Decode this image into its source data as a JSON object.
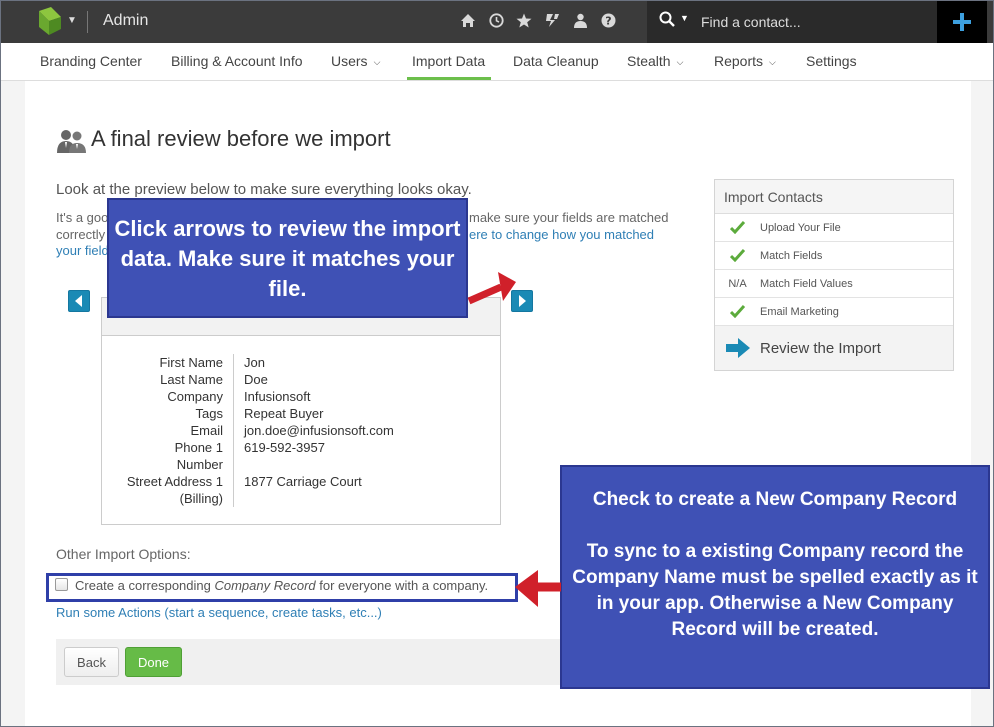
{
  "app": {
    "title": "Admin"
  },
  "search": {
    "placeholder": "Find a contact..."
  },
  "top_icons": [
    "home-icon",
    "history-icon",
    "star-icon",
    "marketplace-icon",
    "user-icon",
    "help-icon"
  ],
  "nav": {
    "items": [
      {
        "label": "Branding Center"
      },
      {
        "label": "Billing & Account Info"
      },
      {
        "label": "Users"
      },
      {
        "label": "Import Data"
      },
      {
        "label": "Data Cleanup"
      },
      {
        "label": "Stealth"
      },
      {
        "label": "Reports"
      },
      {
        "label": "Settings"
      }
    ],
    "active": "Import Data"
  },
  "page": {
    "title": "A final review before we import",
    "intro": "Look at the preview below to make sure everything looks okay.",
    "help_left_1": "It's a goo",
    "help_left_2": "correctly",
    "help_left_3": "your field",
    "help_right_1": "make sure your fields are matched",
    "help_right_link": "ere to change how you matched"
  },
  "preview": {
    "rows": [
      {
        "label": "First Name",
        "value": "Jon"
      },
      {
        "label": "Last Name",
        "value": "Doe"
      },
      {
        "label": "Company",
        "value": "Infusionsoft"
      },
      {
        "label": "Tags",
        "value": "Repeat Buyer"
      },
      {
        "label": "Email",
        "value": "jon.doe@infusionsoft.com"
      },
      {
        "label": "Phone 1",
        "value": "619-592-3957"
      },
      {
        "label": "Number",
        "value": ""
      },
      {
        "label": "Street Address 1",
        "value": "1877 Carriage Court"
      },
      {
        "label": "(Billing)",
        "value": ""
      }
    ]
  },
  "options": {
    "heading": "Other Import Options:",
    "company_record_pre": "Create a corresponding ",
    "company_record_em": "Company Record",
    "company_record_post": " for everyone with a company.",
    "company_record_checked": false,
    "actions_link": "Run some Actions (start a sequence, create tasks, etc...)"
  },
  "buttons": {
    "back": "Back",
    "done": "Done"
  },
  "steps": {
    "title": "Import Contacts",
    "items": [
      {
        "label": "Upload Your File",
        "status": "✔"
      },
      {
        "label": "Match Fields",
        "status": "✔"
      },
      {
        "label": "Match Field Values",
        "status": "N/A"
      },
      {
        "label": "Email Marketing",
        "status": "✔"
      }
    ],
    "current": "Review the Import"
  },
  "callouts": {
    "arrows": "Click arrows to review the import data. Make sure it matches your file.",
    "company_title": "Check to create a New Company Record",
    "company_body": "To sync to a existing Company record the Company Name must be spelled exactly as it in your app. Otherwise a New Company Record will be created."
  },
  "colors": {
    "topbar": "#3b3b3b",
    "accent_green": "#66bb47",
    "link_blue": "#2f7fb5",
    "callout_blue": "#3f51b5",
    "arrow_red": "#d0202a",
    "nav_arrow_blue": "#1a8ab5"
  }
}
